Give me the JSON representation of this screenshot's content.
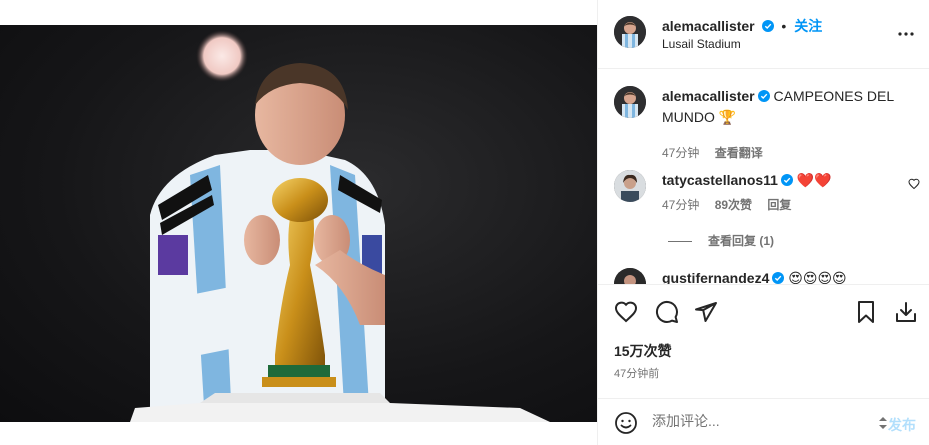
{
  "header": {
    "username": "alemacallister",
    "separator": "•",
    "follow_label": "关注",
    "location": "Lusail Stadium"
  },
  "icons": {
    "verified": "verified-badge-icon",
    "more": "more-options-icon",
    "like": "heart-icon",
    "comment": "comment-icon",
    "share": "paper-plane-icon",
    "save": "bookmark-icon",
    "download": "download-icon",
    "emoji": "emoji-icon"
  },
  "colors": {
    "link_blue": "#0095f6",
    "verified_blue": "#0095f6",
    "heart_red": "#e31b23",
    "muted": "#737373",
    "post_disabled": "#b2dffc"
  },
  "caption": {
    "username": "alemacallister",
    "text": "CAMPEONES DEL MUNDO 🏆",
    "time": "47分钟",
    "translate_label": "查看翻译"
  },
  "comments": [
    {
      "username": "tatycastellanos11",
      "text": "❤️❤️",
      "time": "47分钟",
      "likes": "89次赞",
      "reply_label": "回复",
      "view_replies": "查看回复 (1)"
    },
    {
      "username": "gustifernandez4",
      "text": "😍😍😍😍"
    }
  ],
  "stats": {
    "likes": "15万次赞",
    "time": "47分钟前"
  },
  "add_comment": {
    "placeholder": "添加评论...",
    "post_label": "发布"
  }
}
